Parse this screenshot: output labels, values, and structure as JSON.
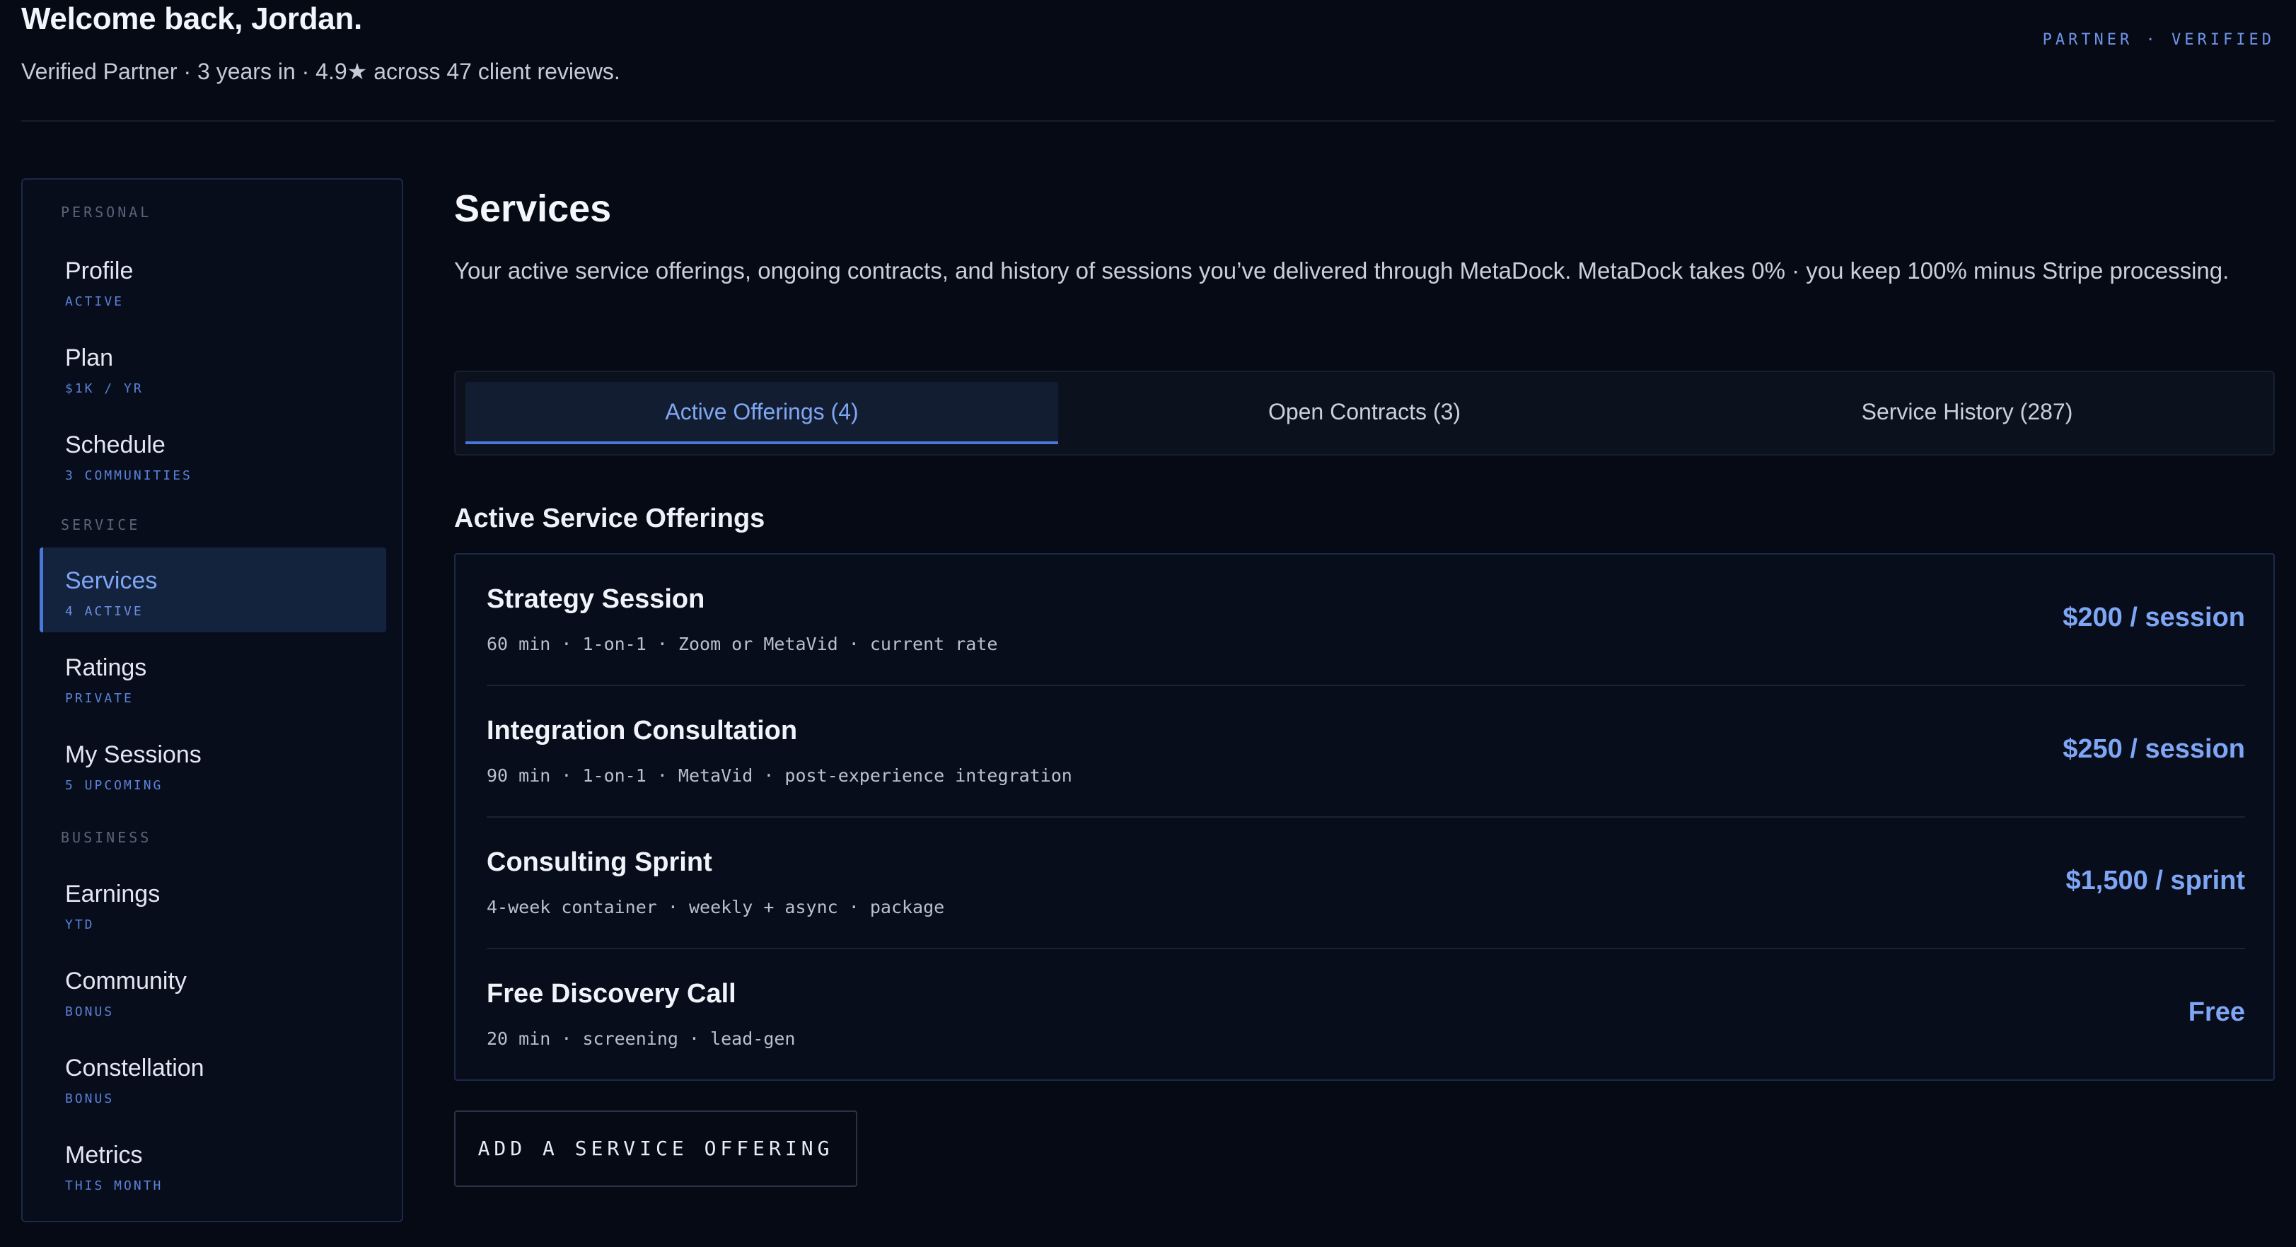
{
  "header": {
    "welcome": "Welcome back, Jordan.",
    "subline": "Verified Partner · 3 years in · 4.9★ across 47 client reviews.",
    "badge": "PARTNER · VERIFIED"
  },
  "sidebar": {
    "sections": [
      {
        "label": "PERSONAL"
      },
      {
        "label": "SERVICE"
      },
      {
        "label": "BUSINESS"
      }
    ],
    "items": [
      {
        "label": "Profile",
        "sub": "ACTIVE"
      },
      {
        "label": "Plan",
        "sub": "$1K / YR"
      },
      {
        "label": "Schedule",
        "sub": "3 COMMUNITIES"
      },
      {
        "label": "Services",
        "sub": "4 ACTIVE",
        "active": true
      },
      {
        "label": "Ratings",
        "sub": "PRIVATE"
      },
      {
        "label": "My Sessions",
        "sub": "5 UPCOMING"
      },
      {
        "label": "Earnings",
        "sub": "YTD"
      },
      {
        "label": "Community",
        "sub": "BONUS"
      },
      {
        "label": "Constellation",
        "sub": "BONUS"
      },
      {
        "label": "Metrics",
        "sub": "THIS MONTH"
      }
    ]
  },
  "main": {
    "title": "Services",
    "intro": "Your active service offerings, ongoing contracts, and history of sessions you’ve delivered through MetaDock. MetaDock takes 0% · you keep 100% minus Stripe processing.",
    "tabs": [
      {
        "label": "Active Offerings (4)",
        "active": true
      },
      {
        "label": "Open Contracts (3)"
      },
      {
        "label": "Service History (287)"
      }
    ],
    "section_title": "Active Service Offerings",
    "offerings": [
      {
        "name": "Strategy Session",
        "meta": "60 min · 1-on-1 · Zoom or MetaVid · current rate",
        "price": "$200 / session"
      },
      {
        "name": "Integration Consultation",
        "meta": "90 min · 1-on-1 · MetaVid · post-experience integration",
        "price": "$250 / session"
      },
      {
        "name": "Consulting Sprint",
        "meta": "4-week container · weekly + async · package",
        "price": "$1,500 / sprint"
      },
      {
        "name": "Free Discovery Call",
        "meta": "20 min · screening · lead-gen",
        "price": "Free"
      }
    ],
    "add_button": "ADD A SERVICE OFFERING"
  },
  "colors": {
    "background": "#050a15",
    "accent": "#7ea6f5",
    "accent_border": "#4a78d9"
  }
}
